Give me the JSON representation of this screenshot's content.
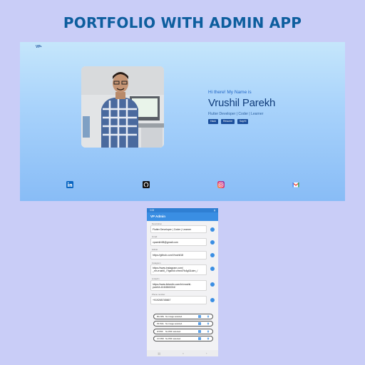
{
  "page_title": "PORTFOLIO WITH ADMIN APP",
  "website": {
    "logo": "VP•",
    "greeting": "Hi there! My Name is",
    "name": "Vrushil Parekh",
    "role": "Flutter Developer | Coder | Learner",
    "buttons": [
      "Hack",
      "Resume",
      "SayHi"
    ],
    "social_icons": [
      "linkedin-icon",
      "github-icon",
      "instagram-icon",
      "gmail-icon"
    ]
  },
  "phone": {
    "status_time": "3:08",
    "appbar_title": "VP Admin",
    "fields": [
      {
        "label": "Description",
        "value": "Flutter Developer | Coder | Learner"
      },
      {
        "label": "Gmail",
        "value": "vparekh98@gmail.com"
      },
      {
        "label": "Github",
        "value": "https://github.com/Vrushil18"
      },
      {
        "label": "Instagram",
        "value": "https://www.instagram.com/\n_mr.vrushil_/?igshid=cfmrd7fv4g0&utm_/"
      },
      {
        "label": "Linkedin",
        "value": "https://www.linkedin.com/in/vrushil-\nparekh-b1646b3244/"
      },
      {
        "label": "Phone number",
        "value": "+919265748667"
      }
    ],
    "uploads": [
      {
        "name": "BG IMG",
        "status": "No image selected."
      },
      {
        "name": "PF IMG",
        "status": "No image selected."
      },
      {
        "name": "W PDF",
        "status": "No PDF selected."
      },
      {
        "name": "CV PDF",
        "status": "No PDF selected."
      }
    ]
  },
  "colors": {
    "accent": "#3a8ee3",
    "title": "#0d5e9e",
    "page_bg": "#c9cdf7"
  }
}
